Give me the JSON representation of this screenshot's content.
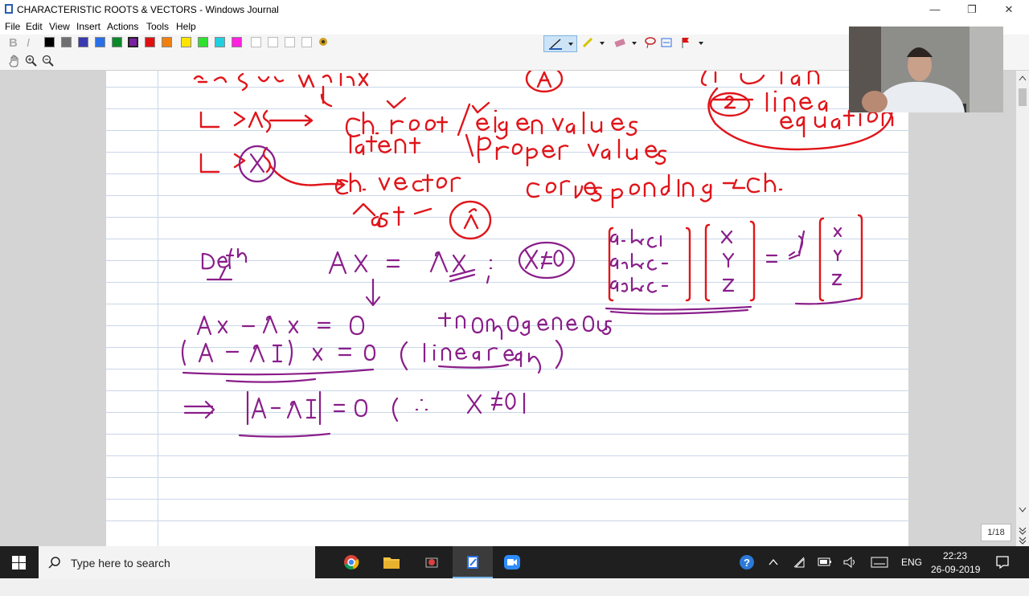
{
  "window": {
    "title": "CHARACTERISTIC ROOTS & VECTORS - Windows Journal",
    "controls": [
      "—",
      "❐",
      "✕"
    ]
  },
  "menu": [
    "File",
    "Edit",
    "View",
    "Insert",
    "Actions",
    "Tools",
    "Help"
  ],
  "toolbar": {
    "bold": "B",
    "italic": "I",
    "pen_colors": [
      "#000000",
      "#707070",
      "#3a3ab0",
      "#2a6fe6",
      "#0a8a2a",
      "#7b1fa2",
      "#e01010",
      "#f08010",
      "#ffe400",
      "#30e030",
      "#20d0e0",
      "#ff20e0",
      "#ffffff",
      "#ffffff",
      "#ffffff",
      "#ffffff"
    ],
    "selected_color": "#7b1fa2"
  },
  "note": {
    "page_indicator": "1/18"
  },
  "taskbar": {
    "search_placeholder": "Type here to search",
    "language": "ENG",
    "time": "22:23",
    "date": "26-09-2019"
  }
}
